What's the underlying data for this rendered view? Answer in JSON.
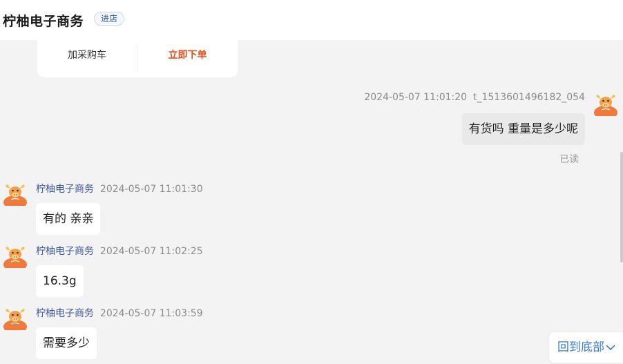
{
  "header": {
    "shop_name": "柠柚电子商务",
    "enter_shop_label": "进店"
  },
  "product_card": {
    "add_cart_label": "加采购车",
    "buy_now_label": "立即下单"
  },
  "messages": [
    {
      "from": "me",
      "timestamp": "2024-05-07 11:01:20",
      "sender": "t_1513601496182_054",
      "text": "有货吗 重量是多少呢",
      "status": "已读"
    },
    {
      "from": "shop",
      "sender": "柠柚电子商务",
      "timestamp": "2024-05-07 11:01:30",
      "text": "有的 亲亲"
    },
    {
      "from": "shop",
      "sender": "柠柚电子商务",
      "timestamp": "2024-05-07 11:02:25",
      "text": "16.3g"
    },
    {
      "from": "shop",
      "sender": "柠柚电子商务",
      "timestamp": "2024-05-07 11:03:59",
      "text": "需要多少"
    }
  ],
  "scroll_to_bottom_label": "回到底部",
  "colors": {
    "accent": "#e84d1c",
    "link": "#3a7bd5",
    "sender": "#3e5a9e"
  }
}
